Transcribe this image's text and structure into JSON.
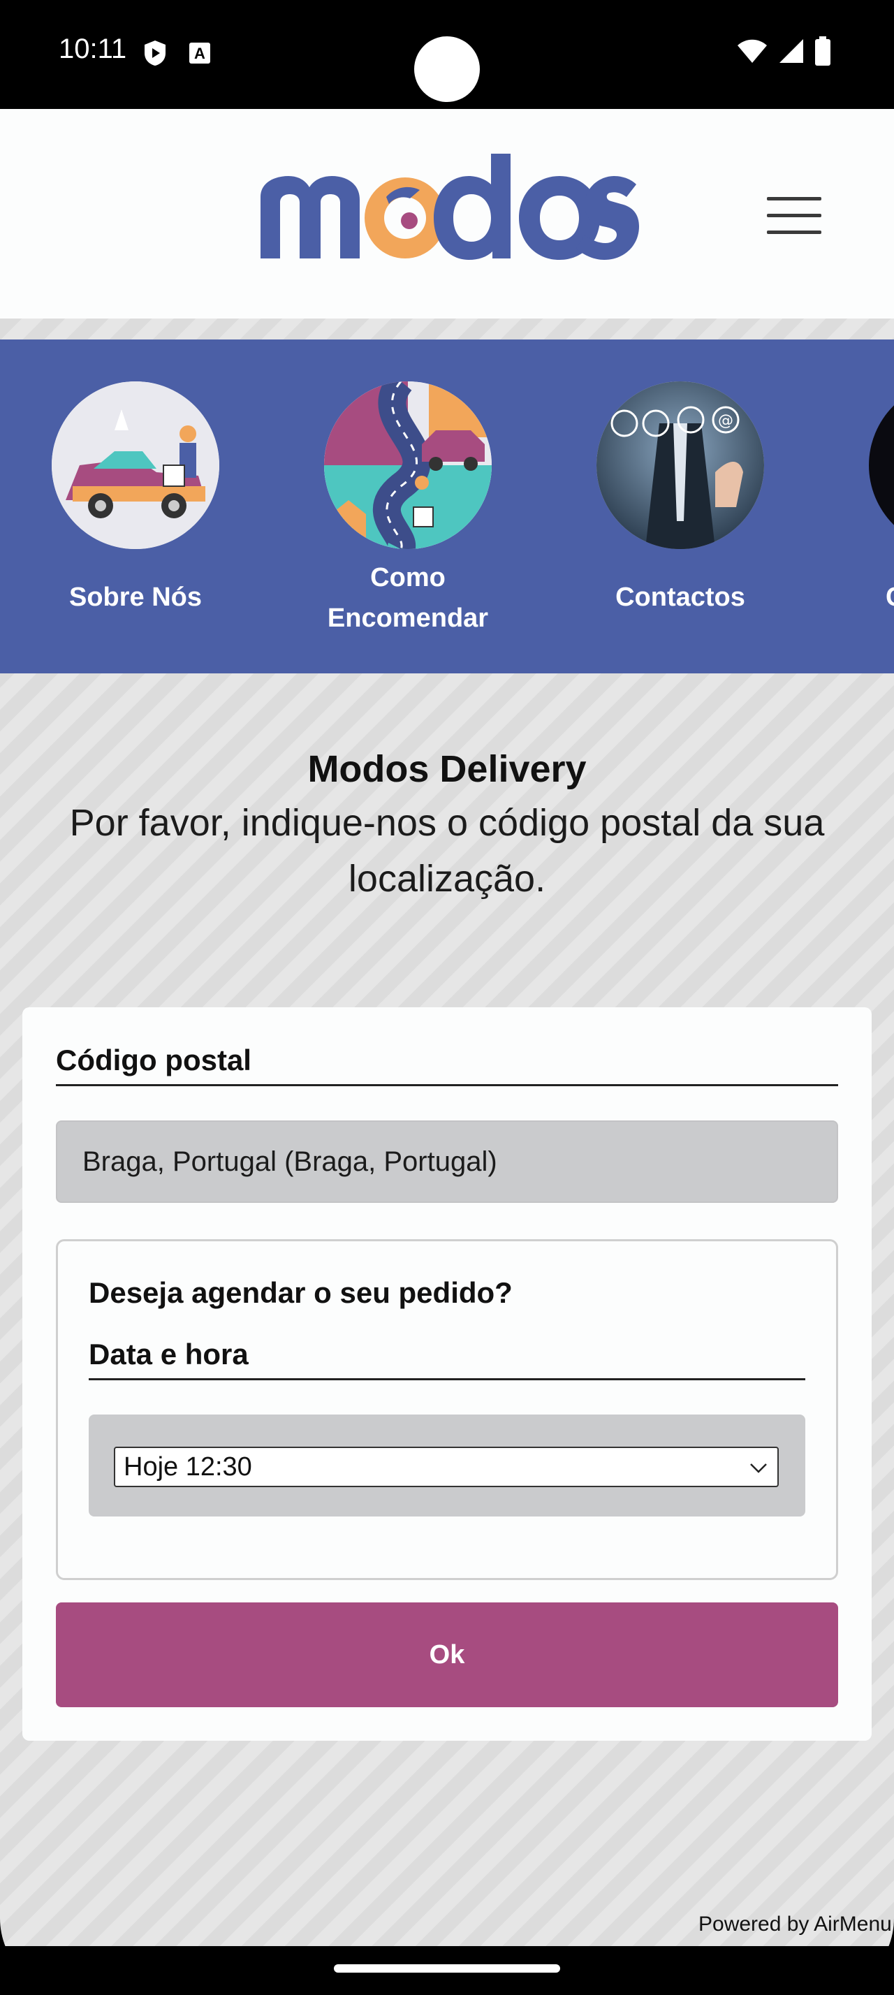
{
  "status_bar": {
    "time": "10:11",
    "icons_left": [
      "shield-play-icon",
      "a-box-icon"
    ],
    "icons_right": [
      "wifi-icon",
      "signal-icon",
      "battery-icon"
    ]
  },
  "header": {
    "logo_text": "modos",
    "menu_icon": "hamburger-menu-icon"
  },
  "categories": [
    {
      "label": "Sobre Nós"
    },
    {
      "label": "Como Encomendar"
    },
    {
      "label": "Contactos"
    },
    {
      "label": "C"
    }
  ],
  "main": {
    "title": "Modos Delivery",
    "subtitle": "Por favor, indique-nos o código postal da sua localização."
  },
  "form": {
    "postal_label": "Código postal",
    "postal_value": "Braga, Portugal (Braga, Portugal)",
    "schedule_question": "Deseja agendar o seu pedido?",
    "datetime_label": "Data e hora",
    "datetime_selected": "Hoje 12:30",
    "ok_label": "Ok"
  },
  "footer": {
    "powered_by": "Powered by AirMenu"
  },
  "colors": {
    "brand_blue": "#4b5fa6",
    "button_magenta": "#a74c80",
    "logo_orange": "#f2a65a"
  }
}
